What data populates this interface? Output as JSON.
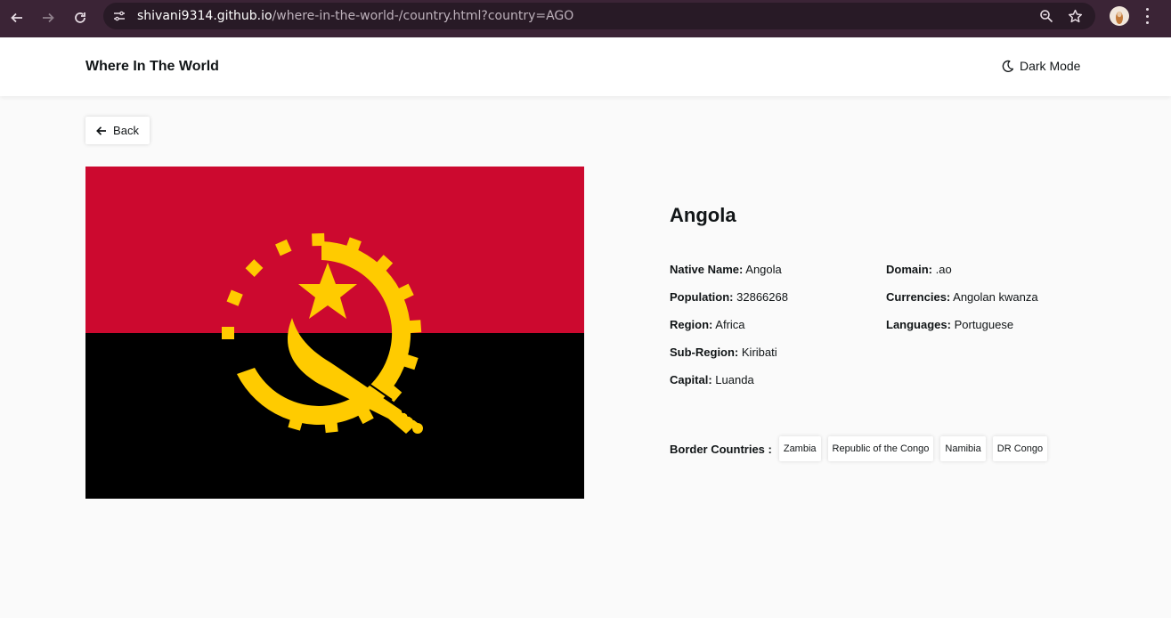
{
  "browser": {
    "url_host": "shivani9314.github.io",
    "url_path": "/where-in-the-world-/country.html?country=AGO"
  },
  "header": {
    "title": "Where In The World",
    "dark_mode_label": "Dark Mode"
  },
  "back_label": "Back",
  "country": {
    "name": "Angola",
    "left_details": [
      {
        "label": "Native Name:",
        "value": "Angola"
      },
      {
        "label": "Population:",
        "value": "32866268"
      },
      {
        "label": "Region:",
        "value": "Africa"
      },
      {
        "label": "Sub-Region:",
        "value": "Kiribati"
      },
      {
        "label": "Capital:",
        "value": "Luanda"
      }
    ],
    "right_details": [
      {
        "label": "Domain:",
        "value": ".ao"
      },
      {
        "label": "Currencies:",
        "value": "Angolan kwanza"
      },
      {
        "label": "Languages:",
        "value": "Portuguese"
      }
    ],
    "border_label": "Border Countries :",
    "borders": [
      "Zambia",
      "Republic of the Congo",
      "Namibia",
      "DR Congo"
    ]
  },
  "colors": {
    "flag_red": "#cc092f",
    "flag_black": "#000000",
    "flag_yellow": "#ffcb00",
    "chrome_bg": "#3b2436"
  },
  "icons": {
    "nav": [
      "back-arrow-icon",
      "forward-arrow-icon",
      "reload-icon"
    ],
    "omnibox": [
      "site-settings-icon",
      "zoom-icon",
      "bookmark-star-icon"
    ],
    "theme": "moon-icon",
    "back": "arrow-left-icon"
  }
}
